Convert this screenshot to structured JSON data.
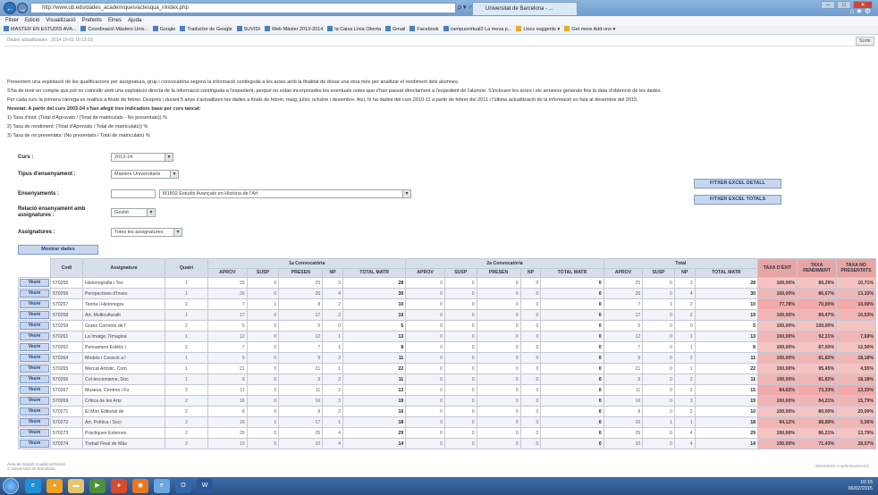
{
  "browser": {
    "url": "http://www.ub.edu/dades_academiques/actesqua_r/index.php",
    "address_ctrl": "ρ ▾ ♂",
    "tab_title": "Universitat de Barcelona - ...",
    "menu": [
      "Fitxer",
      "Edició",
      "Visualització",
      "Preferits",
      "Eines",
      "Ajuda"
    ],
    "favorites": [
      "MASTER EN ESTUDIS AVA...",
      "Coordinació Màsters Univ...",
      "Google",
      "Traductor de Google",
      "SUVIDI",
      "Web Màster 2013-2014",
      "la Caixa Línia Oberta",
      "Gmail",
      "Facebook",
      "campusvirtual2 La meva p...",
      "Llocs suggerits ▾",
      "Get more Add-ons ▾"
    ]
  },
  "page": {
    "updated": "Dades actualitzades : 2014-10-01 10:13:23",
    "sortir": "Sortir",
    "intro": [
      "Presentem una explotació de les qualificacions per assignatura, grup i convocatòria segons la informació continguda a les actes amb la finalitat de donar una eina més per analitzar el rendiment dels alumnes.",
      "S'ha de tenir en compte que pot no coincidir amb una explotació directa de la informació continguda a l'expedient, perquè no estan incorporades les eventuals notes que s'han passat directament a l'expedient de l'alumne. S'inclouen les actes i els annexos generats fins la data d'obtenció de les dades.",
      "Per cada curs la primera càrrega es realitza a finals de febrer. Després i durant 5 anys s'actualitzen les dades a finals de febrer, maig, juliol, octubre i desembre. Així, hi ha dades del curs 2010-11 a partir de febrer del 2011 i l'última actualització de la informació es farà al desembre del 2015.",
      "Novetat: A partir del curs 2003-04 s'han afegit tres indicadors base per curs tancat:",
      "1) Taxa d'èxit: (Total d'Aprovats / (Total de matriculats - No presentats)) %",
      "2) Taxa de rendiment: (Total d'Aprovats / Total de matriculats)) %",
      "3) Taxa de no presentats: (No presentats / Total de matriculats) %"
    ],
    "filters": {
      "curs_label": "Curs :",
      "curs_value": "2013-14",
      "tipus_label": "Tipus d'ensenyament :",
      "tipus_value": "Màsters Universitaris",
      "ens_label": "Ensenyaments :",
      "ens_value": "M1802 Estudis Avançats en Història de l'Art",
      "relacio_label": "Relació ensenyament amb assignatures :",
      "relacio_value": "Gestió",
      "assig_label": "Assignatures :",
      "assig_value": "Totes les assignatures"
    },
    "btn_mostrar": "Mostrar dades",
    "btn_excel_detall": "FITXER EXCEL DETALL",
    "btn_excel_totals": "FITXER EXCEL TOTALS"
  },
  "table": {
    "headers": {
      "codi": "Codi",
      "assignatura": "Assignatura",
      "quatri": "Quatri",
      "conv1": "1a Convocatòria",
      "conv2": "2a Convocatòria",
      "total": "Total",
      "taxa_exit": "TAXA D'ÈXIT",
      "taxa_rend": "TAXA RENDIMENT",
      "taxa_np": "TAXA NO PRESENTATS",
      "sub1": [
        "APROV",
        "SUSP",
        "PRESEN",
        "NP",
        "TOTAL MATR"
      ],
      "sub2": [
        "APROV",
        "SUSP",
        "PRESEN",
        "NP",
        "TOTAL MATR"
      ],
      "sub3": [
        "APROV",
        "SUSP",
        "NP",
        "TOTAL MATR"
      ]
    },
    "veure": "Veure",
    "rows": [
      {
        "codi": "570255",
        "name": "Historiografia i Teo",
        "q": "1",
        "c1": [
          "25",
          "0",
          "25",
          "3",
          "28"
        ],
        "c2": [
          "0",
          "0",
          "0",
          "0",
          "0"
        ],
        "t": [
          "25",
          "0",
          "3",
          "28"
        ],
        "r": [
          "100,00%",
          "89,29%",
          "10,71%"
        ]
      },
      {
        "codi": "570256",
        "name": "Perspectives d'Inves",
        "q": "1",
        "c1": [
          "26",
          "0",
          "26",
          "4",
          "30"
        ],
        "c2": [
          "0",
          "0",
          "0",
          "0",
          "0"
        ],
        "t": [
          "26",
          "0",
          "4",
          "30"
        ],
        "r": [
          "100,00%",
          "86,67%",
          "13,33%"
        ]
      },
      {
        "codi": "570257",
        "name": "Teoria i Historiogra",
        "q": "2",
        "c1": [
          "7",
          "1",
          "8",
          "2",
          "10"
        ],
        "c2": [
          "0",
          "0",
          "0",
          "0",
          "0"
        ],
        "t": [
          "7",
          "1",
          "2",
          "10"
        ],
        "r": [
          "77,78%",
          "70,00%",
          "10,00%"
        ]
      },
      {
        "codi": "570258",
        "name": "Art, Multiculturalit",
        "q": "1",
        "c1": [
          "17",
          "0",
          "17",
          "2",
          "19"
        ],
        "c2": [
          "0",
          "0",
          "0",
          "0",
          "0"
        ],
        "t": [
          "17",
          "0",
          "2",
          "19"
        ],
        "r": [
          "100,00%",
          "89,47%",
          "10,53%"
        ]
      },
      {
        "codi": "570259",
        "name": "Grans Corrents de l'",
        "q": "2",
        "c1": [
          "5",
          "0",
          "5",
          "0",
          "5"
        ],
        "c2": [
          "0",
          "0",
          "0",
          "0",
          "0"
        ],
        "t": [
          "5",
          "0",
          "0",
          "5"
        ],
        "r": [
          "100,00%",
          "100,00%",
          ""
        ]
      },
      {
        "codi": "570261",
        "name": "La Imatge, l'Imagina",
        "q": "1",
        "c1": [
          "12",
          "0",
          "12",
          "1",
          "13"
        ],
        "c2": [
          "0",
          "0",
          "0",
          "0",
          "0"
        ],
        "t": [
          "12",
          "0",
          "1",
          "13"
        ],
        "r": [
          "100,00%",
          "92,31%",
          "7,69%"
        ]
      },
      {
        "codi": "570262",
        "name": "Pensament Estètic i",
        "q": "2",
        "c1": [
          "7",
          "0",
          "7",
          "1",
          "8"
        ],
        "c2": [
          "0",
          "0",
          "0",
          "0",
          "0"
        ],
        "t": [
          "7",
          "0",
          "1",
          "8"
        ],
        "r": [
          "100,00%",
          "87,50%",
          "12,50%"
        ]
      },
      {
        "codi": "570264",
        "name": "Models i Creació a l",
        "q": "1",
        "c1": [
          "9",
          "0",
          "9",
          "2",
          "11"
        ],
        "c2": [
          "0",
          "0",
          "0",
          "0",
          "0"
        ],
        "t": [
          "9",
          "0",
          "2",
          "11"
        ],
        "r": [
          "100,00%",
          "81,82%",
          "18,18%"
        ]
      },
      {
        "codi": "570265",
        "name": "Mercat Artístic, Com",
        "q": "1",
        "c1": [
          "21",
          "0",
          "21",
          "1",
          "22"
        ],
        "c2": [
          "0",
          "0",
          "0",
          "0",
          "0"
        ],
        "t": [
          "21",
          "0",
          "1",
          "22"
        ],
        "r": [
          "100,00%",
          "95,45%",
          "4,55%"
        ]
      },
      {
        "codi": "570266",
        "name": "Col·leccionisme, Doc",
        "q": "1",
        "c1": [
          "9",
          "0",
          "9",
          "2",
          "11"
        ],
        "c2": [
          "0",
          "0",
          "0",
          "0",
          "0"
        ],
        "t": [
          "9",
          "0",
          "2",
          "11"
        ],
        "r": [
          "100,00%",
          "81,82%",
          "18,18%"
        ]
      },
      {
        "codi": "570267",
        "name": "Museus, Centres i Fu",
        "q": "2",
        "c1": [
          "11",
          "0",
          "11",
          "2",
          "13"
        ],
        "c2": [
          "0",
          "0",
          "0",
          "0",
          "0"
        ],
        "t": [
          "11",
          "0",
          "2",
          "15"
        ],
        "r": [
          "84,62%",
          "73,33%",
          "13,33%"
        ]
      },
      {
        "codi": "570269",
        "name": "Crítica de les Arts",
        "q": "2",
        "c1": [
          "16",
          "0",
          "16",
          "3",
          "19"
        ],
        "c2": [
          "0",
          "0",
          "0",
          "0",
          "0"
        ],
        "t": [
          "16",
          "0",
          "3",
          "19"
        ],
        "r": [
          "100,00%",
          "84,21%",
          "15,79%"
        ]
      },
      {
        "codi": "570271",
        "name": "El Món Editorial de",
        "q": "2",
        "c1": [
          "8",
          "0",
          "8",
          "2",
          "10"
        ],
        "c2": [
          "0",
          "0",
          "0",
          "0",
          "0"
        ],
        "t": [
          "8",
          "0",
          "2",
          "10"
        ],
        "r": [
          "100,00%",
          "80,00%",
          "20,00%"
        ]
      },
      {
        "codi": "570272",
        "name": "Art, Política i Soci",
        "q": "2",
        "c1": [
          "16",
          "1",
          "17",
          "1",
          "18"
        ],
        "c2": [
          "0",
          "0",
          "0",
          "0",
          "0"
        ],
        "t": [
          "16",
          "1",
          "1",
          "18"
        ],
        "r": [
          "94,12%",
          "88,89%",
          "5,56%"
        ]
      },
      {
        "codi": "570273",
        "name": "Pràctiques Externes",
        "q": "2",
        "c1": [
          "25",
          "0",
          "25",
          "4",
          "29"
        ],
        "c2": [
          "0",
          "0",
          "0",
          "0",
          "0"
        ],
        "t": [
          "25",
          "0",
          "4",
          "29"
        ],
        "r": [
          "100,00%",
          "86,21%",
          "13,79%"
        ]
      },
      {
        "codi": "570274",
        "name": "Treball Final de Màs",
        "q": "2",
        "c1": [
          "10",
          "0",
          "10",
          "4",
          "14"
        ],
        "c2": [
          "0",
          "0",
          "0",
          "0",
          "0"
        ],
        "t": [
          "10",
          "0",
          "4",
          "14"
        ],
        "r": [
          "100,00%",
          "71,43%",
          "28,57%"
        ]
      }
    ]
  },
  "footer": {
    "left1": "Àrea de Suport Acadèmic/Gestió",
    "left2": "© Universitat de Barcelona",
    "right": "Webmàster Acadèmica/Gestió"
  },
  "taskbar": {
    "time": "10:15",
    "date": "06/02/2015"
  }
}
